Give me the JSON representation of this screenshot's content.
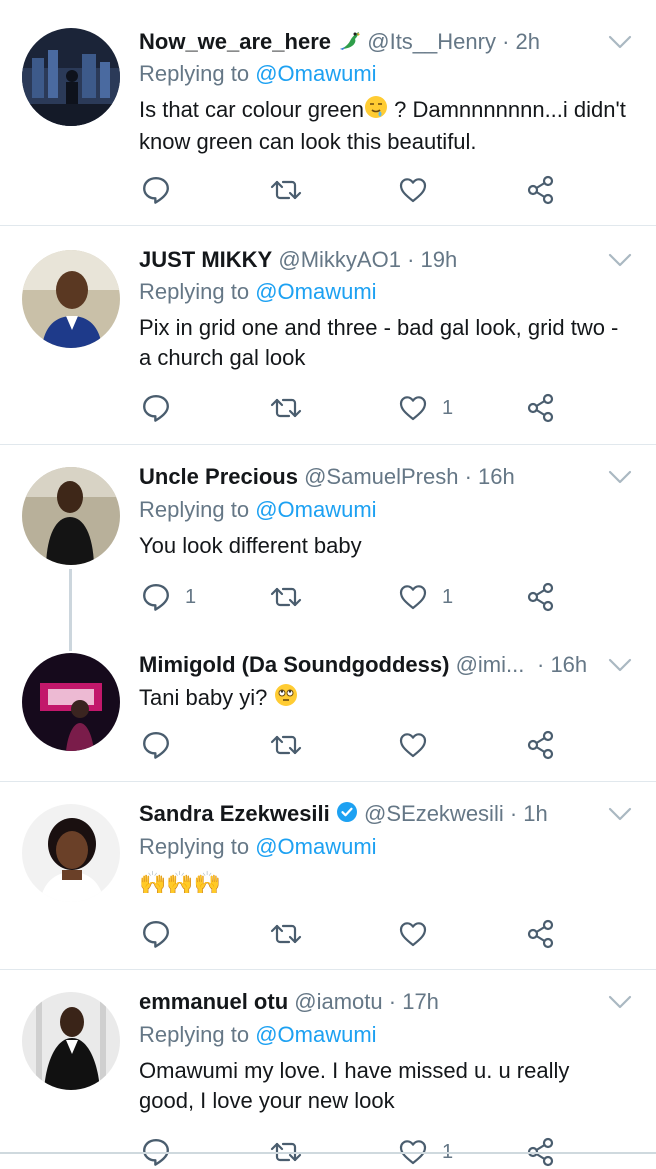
{
  "tweets": [
    {
      "name": "Now_we_are_here",
      "handle": "@Its__Henry",
      "time": "· 2h",
      "reply_prefix": "Replying to",
      "reply_to": "@Omawumi",
      "text_1": "Is that car colour green",
      "text_2": " ? Damnnnnnnn...i didn't",
      "text_3": "know green can look this beautiful.",
      "reply_count": "",
      "retweet_count": "",
      "like_count": ""
    },
    {
      "name": "JUST MIKKY",
      "handle": "@MikkyAO1",
      "time": "· 19h",
      "reply_prefix": "Replying to",
      "reply_to": "@Omawumi",
      "text_1": "Pix in grid one and three - bad gal look, grid two -",
      "text_2": "a church gal look",
      "reply_count": "",
      "retweet_count": "",
      "like_count": "1"
    },
    {
      "name": "Uncle Precious",
      "handle": "@SamuelPresh",
      "time": "· 16h",
      "reply_prefix": "Replying to",
      "reply_to": "@Omawumi",
      "text_1": "You look different baby",
      "reply_count": "1",
      "retweet_count": "",
      "like_count": "1"
    },
    {
      "name": "Mimigold (Da Soundgoddess)",
      "handle": "@imi...",
      "time": "· 16h",
      "text_1": "Tani baby yi?",
      "reply_count": "",
      "retweet_count": "",
      "like_count": ""
    },
    {
      "name": "Sandra Ezekwesili",
      "handle": "@SEzekwesili",
      "time": "· 1h",
      "reply_prefix": "Replying to",
      "reply_to": "@Omawumi",
      "text_1": "🙌🙌🙌",
      "reply_count": "",
      "retweet_count": "",
      "like_count": ""
    },
    {
      "name": "emmanuel otu",
      "handle": "@iamotu",
      "time": "· 17h",
      "reply_prefix": "Replying to",
      "reply_to": "@Omawumi",
      "text_1": "Omawumi my love. I have missed u. u really",
      "text_2": "good, I love your new look",
      "reply_count": "",
      "retweet_count": "",
      "like_count": "1"
    }
  ],
  "colors": {
    "text": "#14171a",
    "muted": "#657786",
    "link": "#1da1f2",
    "divider": "#e1e8ed",
    "verified": "#1da1f2"
  },
  "icons": {
    "reply": "reply-icon",
    "retweet": "retweet-icon",
    "like": "heart-icon",
    "share": "share-icon",
    "menu": "chevron-down-icon",
    "verified": "verified-badge-icon"
  }
}
